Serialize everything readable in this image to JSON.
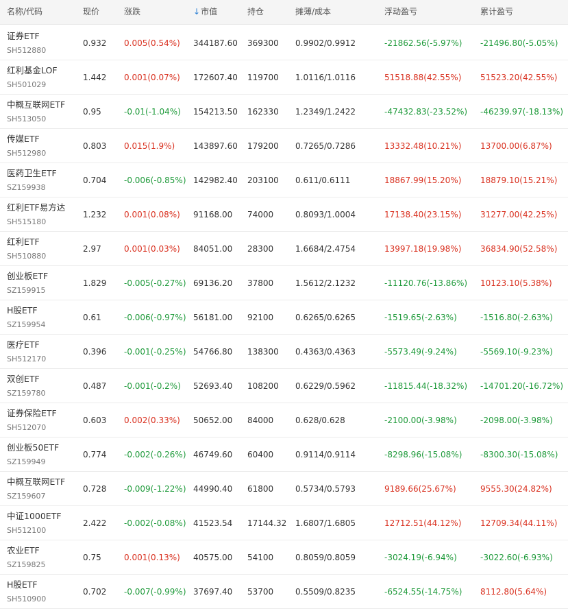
{
  "header": {
    "name_code": "名称/代码",
    "price": "现价",
    "change": "涨跌",
    "sort_arrow": "↓",
    "market_value": "市值",
    "position": "持仓",
    "cost": "摊薄/成本",
    "float_pnl": "浮动盈亏",
    "total_pnl": "累计盈亏"
  },
  "colors": {
    "up": "#d9301f",
    "down": "#1e9a3a",
    "sort": "#2b7fd4"
  },
  "rows": [
    {
      "name": "证券ETF",
      "code": "SH512880",
      "price": "0.932",
      "change": "0.005(0.54%)",
      "change_dir": "up",
      "market_value": "344187.60",
      "position": "369300",
      "cost": "0.9902/0.9912",
      "float_pnl": "-21862.56(-5.97%)",
      "float_dir": "down",
      "total_pnl": "-21496.80(-5.05%)",
      "total_dir": "down"
    },
    {
      "name": "红利基金LOF",
      "code": "SH501029",
      "price": "1.442",
      "change": "0.001(0.07%)",
      "change_dir": "up",
      "market_value": "172607.40",
      "position": "119700",
      "cost": "1.0116/1.0116",
      "float_pnl": "51518.88(42.55%)",
      "float_dir": "up",
      "total_pnl": "51523.20(42.55%)",
      "total_dir": "up"
    },
    {
      "name": "中概互联网ETF",
      "code": "SH513050",
      "price": "0.95",
      "change": "-0.01(-1.04%)",
      "change_dir": "down",
      "market_value": "154213.50",
      "position": "162330",
      "cost": "1.2349/1.2422",
      "float_pnl": "-47432.83(-23.52%)",
      "float_dir": "down",
      "total_pnl": "-46239.97(-18.13%)",
      "total_dir": "down"
    },
    {
      "name": "传媒ETF",
      "code": "SH512980",
      "price": "0.803",
      "change": "0.015(1.9%)",
      "change_dir": "up",
      "market_value": "143897.60",
      "position": "179200",
      "cost": "0.7265/0.7286",
      "float_pnl": "13332.48(10.21%)",
      "float_dir": "up",
      "total_pnl": "13700.00(6.87%)",
      "total_dir": "up"
    },
    {
      "name": "医药卫生ETF",
      "code": "SZ159938",
      "price": "0.704",
      "change": "-0.006(-0.85%)",
      "change_dir": "down",
      "market_value": "142982.40",
      "position": "203100",
      "cost": "0.611/0.6111",
      "float_pnl": "18867.99(15.20%)",
      "float_dir": "up",
      "total_pnl": "18879.10(15.21%)",
      "total_dir": "up"
    },
    {
      "name": "红利ETF易方达",
      "code": "SH515180",
      "price": "1.232",
      "change": "0.001(0.08%)",
      "change_dir": "up",
      "market_value": "91168.00",
      "position": "74000",
      "cost": "0.8093/1.0004",
      "float_pnl": "17138.40(23.15%)",
      "float_dir": "up",
      "total_pnl": "31277.00(42.25%)",
      "total_dir": "up"
    },
    {
      "name": "红利ETF",
      "code": "SH510880",
      "price": "2.97",
      "change": "0.001(0.03%)",
      "change_dir": "up",
      "market_value": "84051.00",
      "position": "28300",
      "cost": "1.6684/2.4754",
      "float_pnl": "13997.18(19.98%)",
      "float_dir": "up",
      "total_pnl": "36834.90(52.58%)",
      "total_dir": "up"
    },
    {
      "name": "创业板ETF",
      "code": "SZ159915",
      "price": "1.829",
      "change": "-0.005(-0.27%)",
      "change_dir": "down",
      "market_value": "69136.20",
      "position": "37800",
      "cost": "1.5612/2.1232",
      "float_pnl": "-11120.76(-13.86%)",
      "float_dir": "down",
      "total_pnl": "10123.10(5.38%)",
      "total_dir": "up"
    },
    {
      "name": "H股ETF",
      "code": "SZ159954",
      "price": "0.61",
      "change": "-0.006(-0.97%)",
      "change_dir": "down",
      "market_value": "56181.00",
      "position": "92100",
      "cost": "0.6265/0.6265",
      "float_pnl": "-1519.65(-2.63%)",
      "float_dir": "down",
      "total_pnl": "-1516.80(-2.63%)",
      "total_dir": "down"
    },
    {
      "name": "医疗ETF",
      "code": "SH512170",
      "price": "0.396",
      "change": "-0.001(-0.25%)",
      "change_dir": "down",
      "market_value": "54766.80",
      "position": "138300",
      "cost": "0.4363/0.4363",
      "float_pnl": "-5573.49(-9.24%)",
      "float_dir": "down",
      "total_pnl": "-5569.10(-9.23%)",
      "total_dir": "down"
    },
    {
      "name": "双创ETF",
      "code": "SZ159780",
      "price": "0.487",
      "change": "-0.001(-0.2%)",
      "change_dir": "down",
      "market_value": "52693.40",
      "position": "108200",
      "cost": "0.6229/0.5962",
      "float_pnl": "-11815.44(-18.32%)",
      "float_dir": "down",
      "total_pnl": "-14701.20(-16.72%)",
      "total_dir": "down"
    },
    {
      "name": "证券保险ETF",
      "code": "SH512070",
      "price": "0.603",
      "change": "0.002(0.33%)",
      "change_dir": "up",
      "market_value": "50652.00",
      "position": "84000",
      "cost": "0.628/0.628",
      "float_pnl": "-2100.00(-3.98%)",
      "float_dir": "down",
      "total_pnl": "-2098.00(-3.98%)",
      "total_dir": "down"
    },
    {
      "name": "创业板50ETF",
      "code": "SZ159949",
      "price": "0.774",
      "change": "-0.002(-0.26%)",
      "change_dir": "down",
      "market_value": "46749.60",
      "position": "60400",
      "cost": "0.9114/0.9114",
      "float_pnl": "-8298.96(-15.08%)",
      "float_dir": "down",
      "total_pnl": "-8300.30(-15.08%)",
      "total_dir": "down"
    },
    {
      "name": "中概互联网ETF",
      "code": "SZ159607",
      "price": "0.728",
      "change": "-0.009(-1.22%)",
      "change_dir": "down",
      "market_value": "44990.40",
      "position": "61800",
      "cost": "0.5734/0.5793",
      "float_pnl": "9189.66(25.67%)",
      "float_dir": "up",
      "total_pnl": "9555.30(24.82%)",
      "total_dir": "up"
    },
    {
      "name": "中证1000ETF",
      "code": "SH512100",
      "price": "2.422",
      "change": "-0.002(-0.08%)",
      "change_dir": "down",
      "market_value": "41523.54",
      "position": "17144.32",
      "cost": "1.6807/1.6805",
      "float_pnl": "12712.51(44.12%)",
      "float_dir": "up",
      "total_pnl": "12709.34(44.11%)",
      "total_dir": "up"
    },
    {
      "name": "农业ETF",
      "code": "SZ159825",
      "price": "0.75",
      "change": "0.001(0.13%)",
      "change_dir": "up",
      "market_value": "40575.00",
      "position": "54100",
      "cost": "0.8059/0.8059",
      "float_pnl": "-3024.19(-6.94%)",
      "float_dir": "down",
      "total_pnl": "-3022.60(-6.93%)",
      "total_dir": "down"
    },
    {
      "name": "H股ETF",
      "code": "SH510900",
      "price": "0.702",
      "change": "-0.007(-0.99%)",
      "change_dir": "down",
      "market_value": "37697.40",
      "position": "53700",
      "cost": "0.5509/0.8235",
      "float_pnl": "-6524.55(-14.75%)",
      "float_dir": "down",
      "total_pnl": "8112.80(5.64%)",
      "total_dir": "up"
    }
  ]
}
